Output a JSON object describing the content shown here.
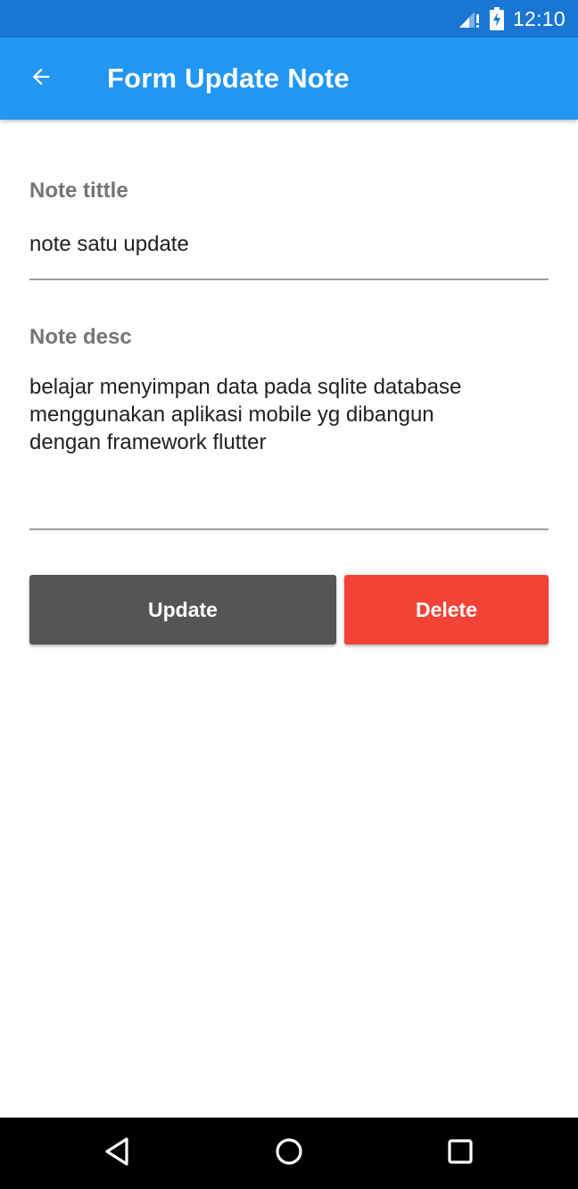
{
  "status_bar": {
    "time": "12:10",
    "signal_icon": "signal-no-data-icon",
    "battery_icon": "battery-charging-icon",
    "color": "#1976d2"
  },
  "app_bar": {
    "title": "Form Update Note",
    "back_icon": "arrow-back-icon",
    "color": "#2196f3"
  },
  "form": {
    "title_field": {
      "label": "Note tittle",
      "value": "note satu update"
    },
    "desc_field": {
      "label": "Note desc",
      "value": "belajar menyimpan data pada sqlite database\nmenggunakan aplikasi mobile yg dibangun\ndengan framework flutter"
    }
  },
  "buttons": {
    "update_label": "Update",
    "delete_label": "Delete",
    "update_color": "#555555",
    "delete_color": "#f44336"
  },
  "nav_bar": {
    "back_icon": "triangle-back-icon",
    "home_icon": "circle-home-icon",
    "recents_icon": "square-recents-icon"
  }
}
